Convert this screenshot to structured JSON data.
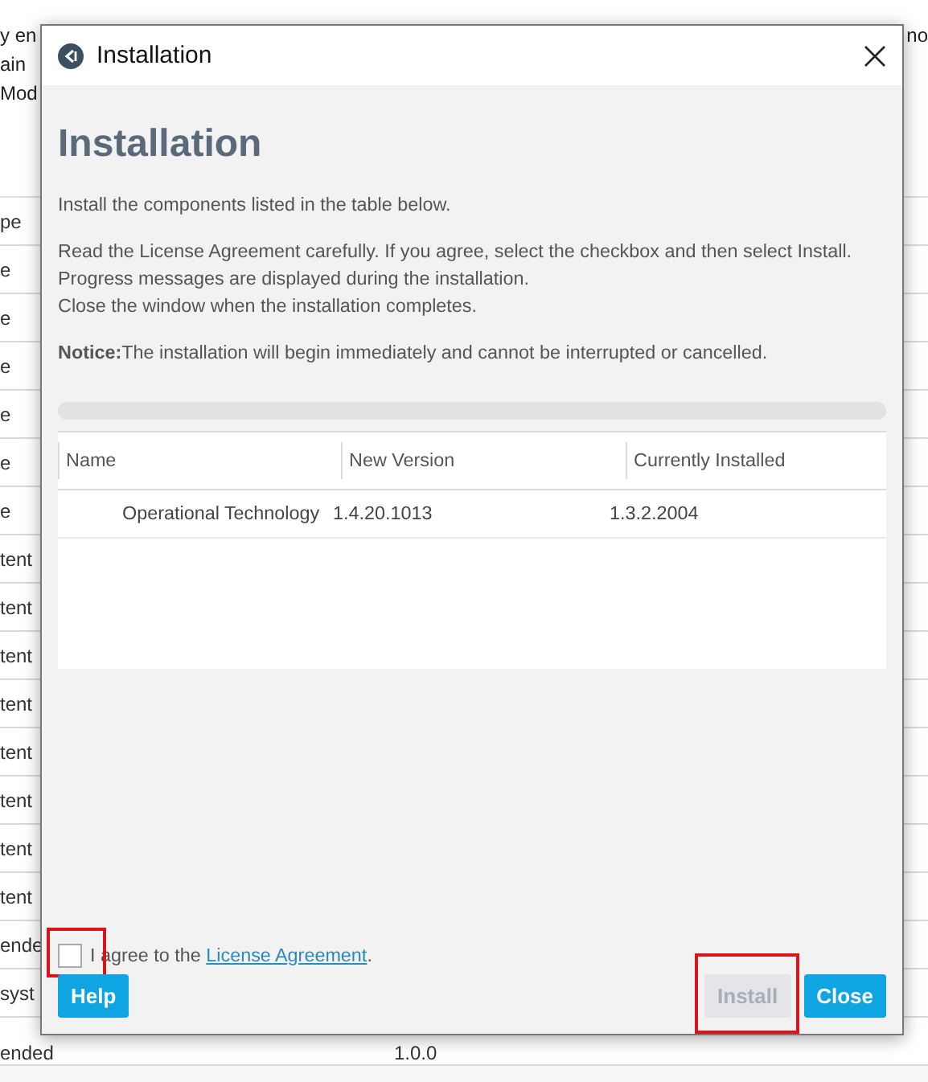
{
  "background": {
    "top_texts": [
      "y en",
      "ain",
      "Mod"
    ],
    "right_text": "no",
    "rows": [
      {
        "cells": [
          "pe"
        ]
      },
      {
        "cells": [
          "e"
        ]
      },
      {
        "cells": [
          "e"
        ]
      },
      {
        "cells": [
          "e"
        ]
      },
      {
        "cells": [
          "e"
        ]
      },
      {
        "cells": [
          "e"
        ]
      },
      {
        "cells": [
          "e"
        ]
      },
      {
        "cells": [
          "tent"
        ]
      },
      {
        "cells": [
          "tent"
        ]
      },
      {
        "cells": [
          "tent"
        ]
      },
      {
        "cells": [
          "tent"
        ]
      },
      {
        "cells": [
          "tent"
        ]
      },
      {
        "cells": [
          "tent"
        ]
      },
      {
        "cells": [
          "tent"
        ]
      },
      {
        "cells": [
          "tent"
        ]
      },
      {
        "cells": [
          "ende"
        ]
      },
      {
        "cells": [
          "syst"
        ]
      },
      {
        "cells": [
          "ended",
          "1.0.0"
        ]
      }
    ]
  },
  "dialog": {
    "title": "Installation",
    "heading": "Installation",
    "paragraphs": [
      [
        "Install the components listed in the table below."
      ],
      [
        "Read the License Agreement carefully. If you agree, select the checkbox and then select Install.",
        "Progress messages are displayed during the installation.",
        "Close the window when the installation completes."
      ],
      [
        "**Notice:**The installation will begin immediately and cannot be interrupted or cancelled."
      ]
    ],
    "progress": {
      "level": 0
    },
    "table": {
      "columns": [
        "Name",
        "New Version",
        "Currently Installed"
      ],
      "rows": [
        [
          "Operational Technology",
          "1.4.20.1013",
          "1.3.2.2004"
        ]
      ]
    },
    "agreement": {
      "checked": false,
      "highlighted": true,
      "text": "I agree to the ",
      "link": "License Agreement",
      "after": "."
    },
    "left_buttons": [
      {
        "label": "Help",
        "disabled": false,
        "highlighted": false
      }
    ],
    "right_buttons": [
      {
        "label": "Install",
        "disabled": true,
        "highlighted": true
      },
      {
        "label": "Close",
        "disabled": false,
        "highlighted": false
      }
    ]
  }
}
